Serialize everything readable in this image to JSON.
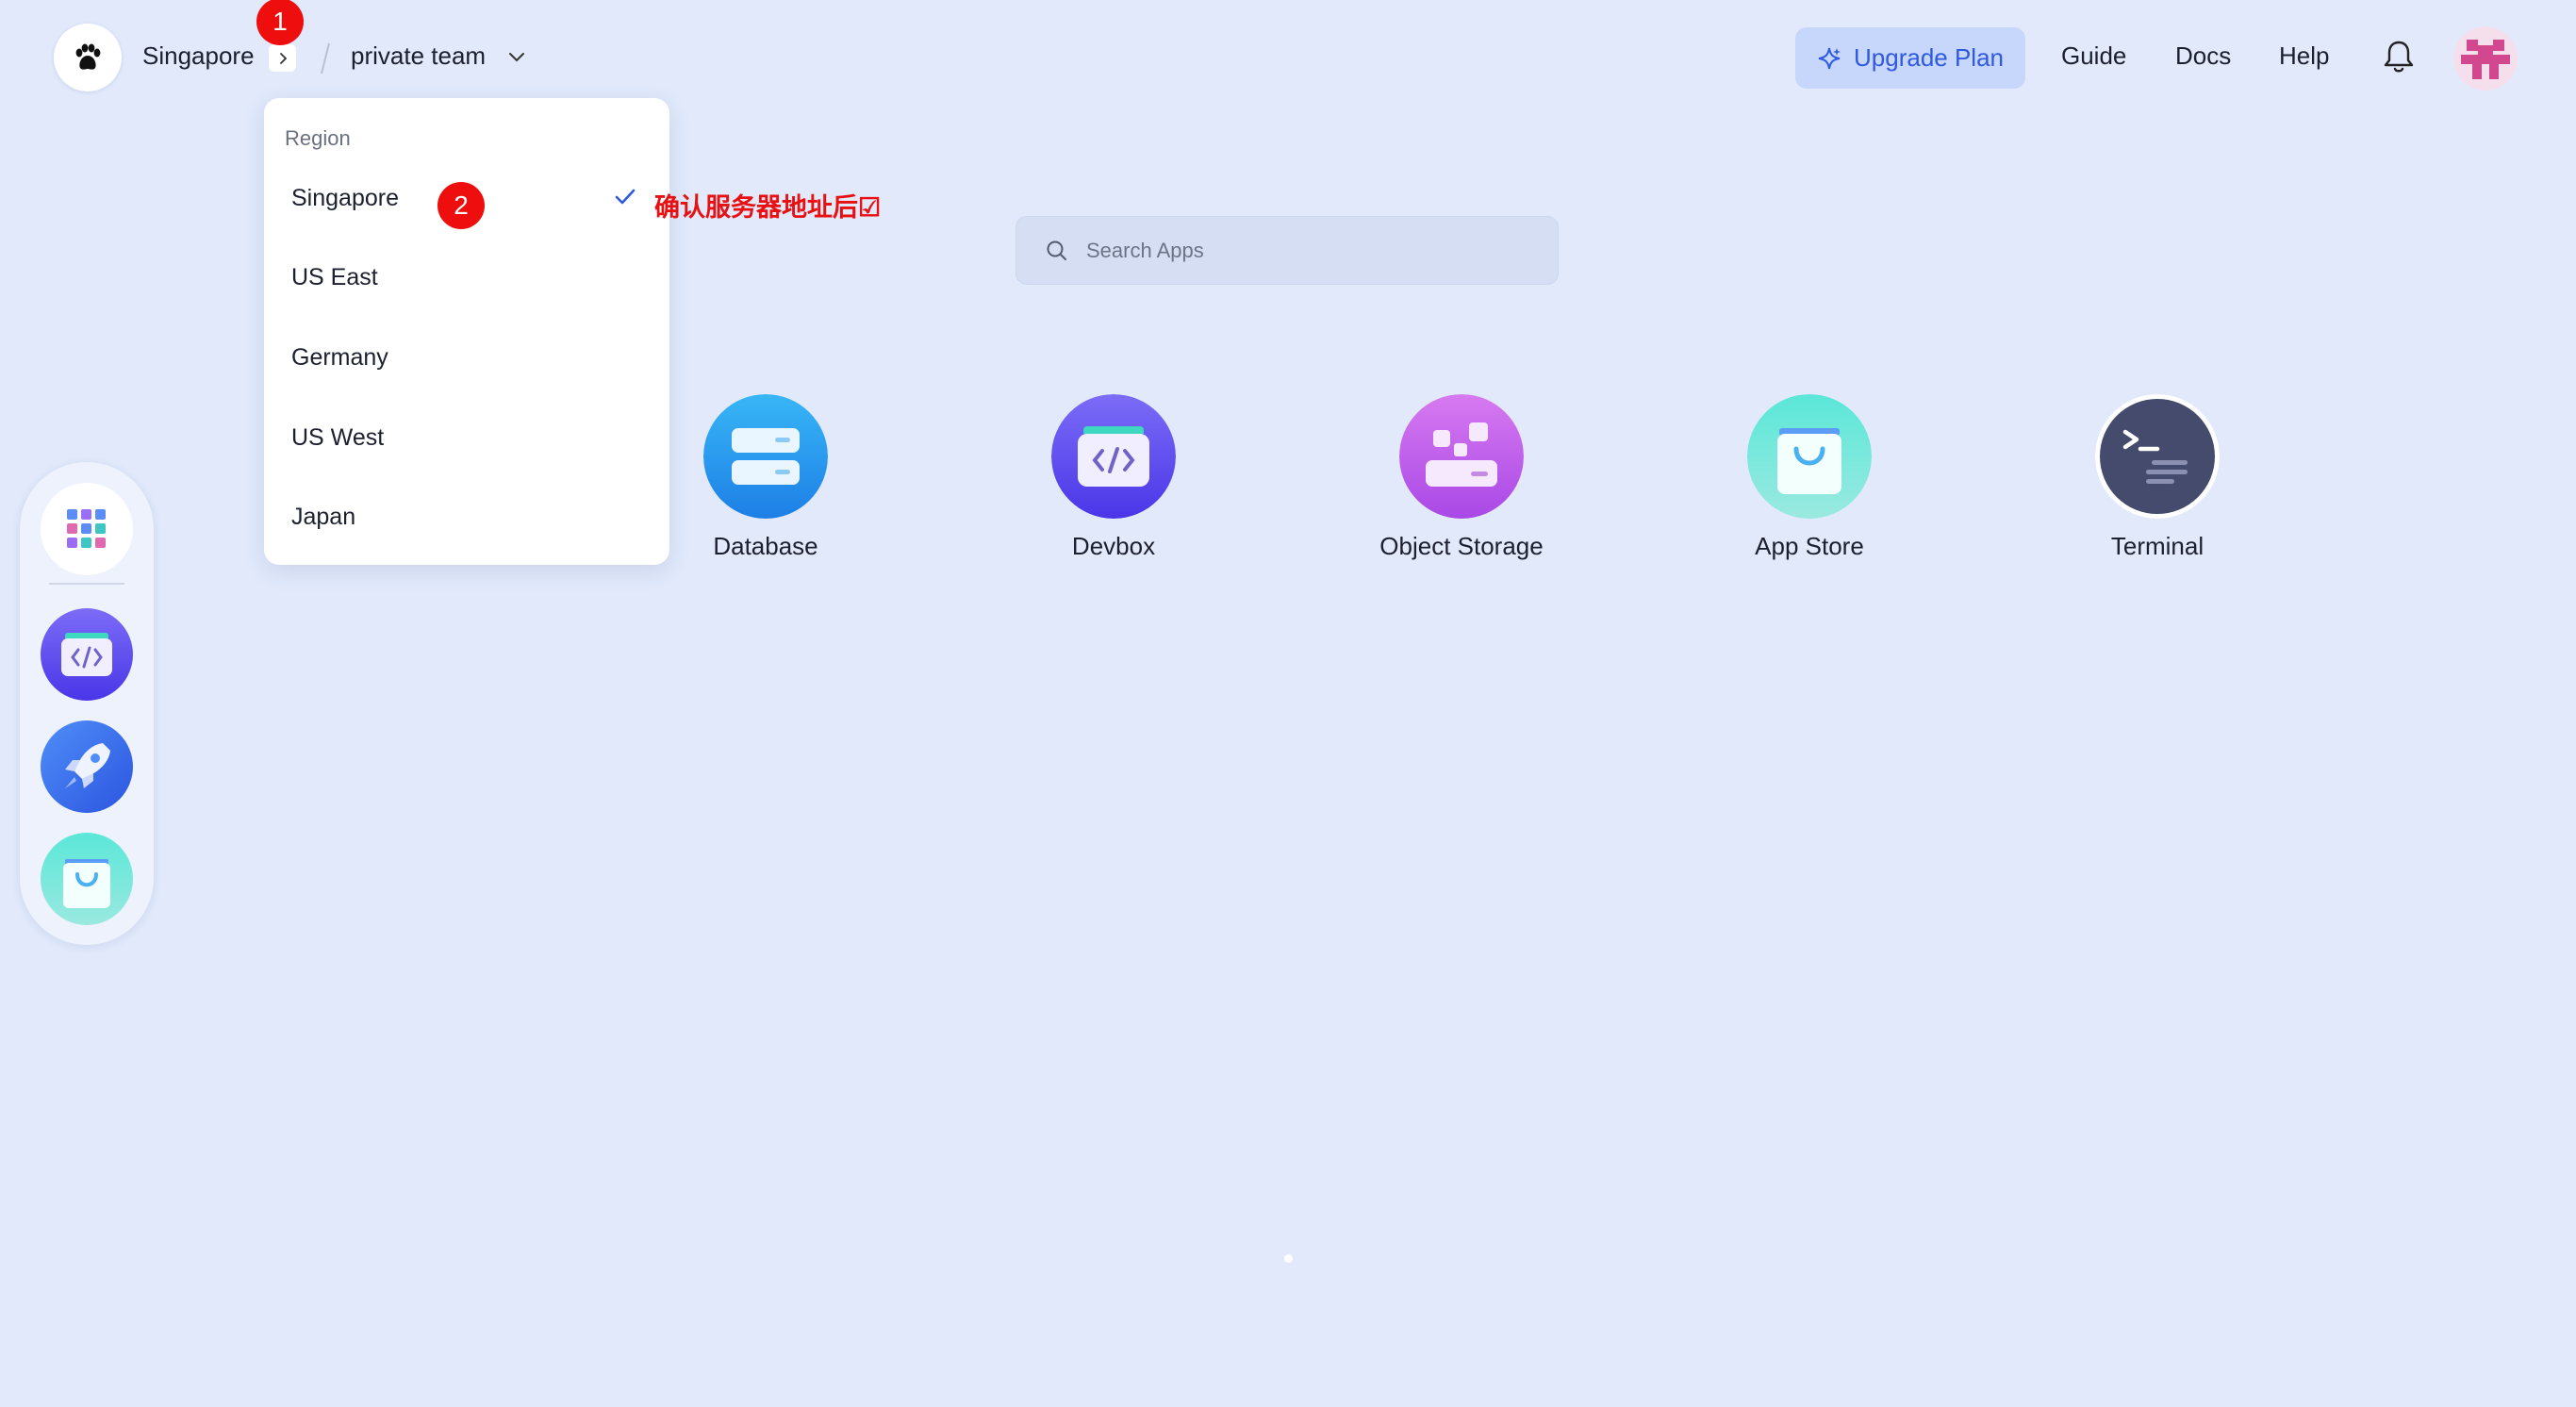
{
  "header": {
    "region": "Singapore",
    "team": "private team",
    "upgrade_label": "Upgrade Plan",
    "nav": [
      "Guide",
      "Docs",
      "Help"
    ]
  },
  "region_dropdown": {
    "heading": "Region",
    "items": [
      "Singapore",
      "US East",
      "Germany",
      "US West",
      "Japan"
    ],
    "selected": "Singapore"
  },
  "annotations": {
    "badge1": "1",
    "badge2": "2",
    "note": "确认服务器地址后☑"
  },
  "search": {
    "placeholder": "Search Apps",
    "value": ""
  },
  "apps": [
    "Database",
    "Devbox",
    "Object Storage",
    "App Store",
    "Terminal"
  ],
  "dock": {
    "items": [
      "apps-grid-icon",
      "devbox-icon",
      "launchpad-rocket-icon",
      "app-store-icon"
    ]
  },
  "colors": {
    "background": "#e1e9fb",
    "accent": "#2f59e0",
    "annotation": "#ee0e0e"
  }
}
